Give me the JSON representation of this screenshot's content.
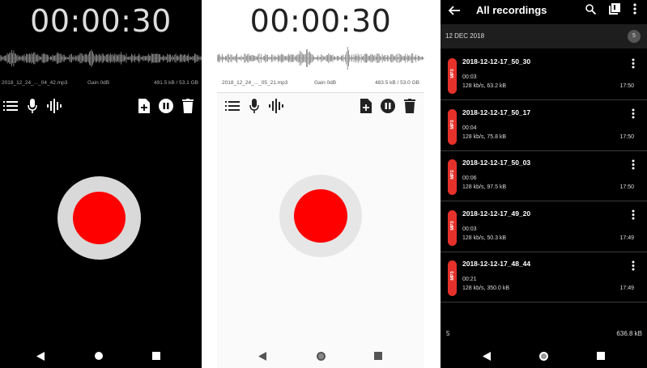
{
  "recorder_dark": {
    "timer": "00:00:30",
    "filename": "2018_12_24_..._04_42.mp3",
    "gain": "Gain 0dB",
    "size": "491.5 kB / 53.1 GB"
  },
  "recorder_light": {
    "timer": "00:00:30",
    "filename": "2018_12_24_..._05_21.mp3",
    "gain": "Gain 0dB",
    "size": "483.5 kB / 53.0 GB"
  },
  "toolbar_icons": [
    "list-icon",
    "microphone-icon",
    "waveform-icon",
    "add-file-icon",
    "pause-icon",
    "trash-icon"
  ],
  "nav_icons": [
    "back-triangle-icon",
    "home-circle-icon",
    "recents-square-icon"
  ],
  "recordings_list": {
    "title": "All recordings",
    "date_header": "12 DEC 2018",
    "date_count": "5",
    "items": [
      {
        "tag": "MP3",
        "name": "2018-12-12-17_50_30",
        "duration": "00:03",
        "meta": "128 kb/s, 63.2 kB",
        "time": "17:50"
      },
      {
        "tag": "MP3",
        "name": "2018-12-12-17_50_17",
        "duration": "00:04",
        "meta": "128 kb/s, 75.8 kB",
        "time": "17:50"
      },
      {
        "tag": "MP3",
        "name": "2018-12-12-17_50_03",
        "duration": "00:06",
        "meta": "128 kb/s, 97.5 kB",
        "time": "17:50"
      },
      {
        "tag": "MP3",
        "name": "2018-12-12-17_49_20",
        "duration": "00:03",
        "meta": "128 kb/s, 50.3 kB",
        "time": "17:49"
      },
      {
        "tag": "MP3",
        "name": "2018-12-12-17_48_44",
        "duration": "00:21",
        "meta": "128 kb/s, 350.0 kB",
        "time": "17:49"
      }
    ],
    "footer_count": "5",
    "footer_size": "636.8 kB"
  },
  "colors": {
    "record_red": "#ff0000",
    "record_ring_dark": "#d9d9d9",
    "record_ring_light": "#e6e6e6",
    "mp3_tag": "#e5312a"
  }
}
